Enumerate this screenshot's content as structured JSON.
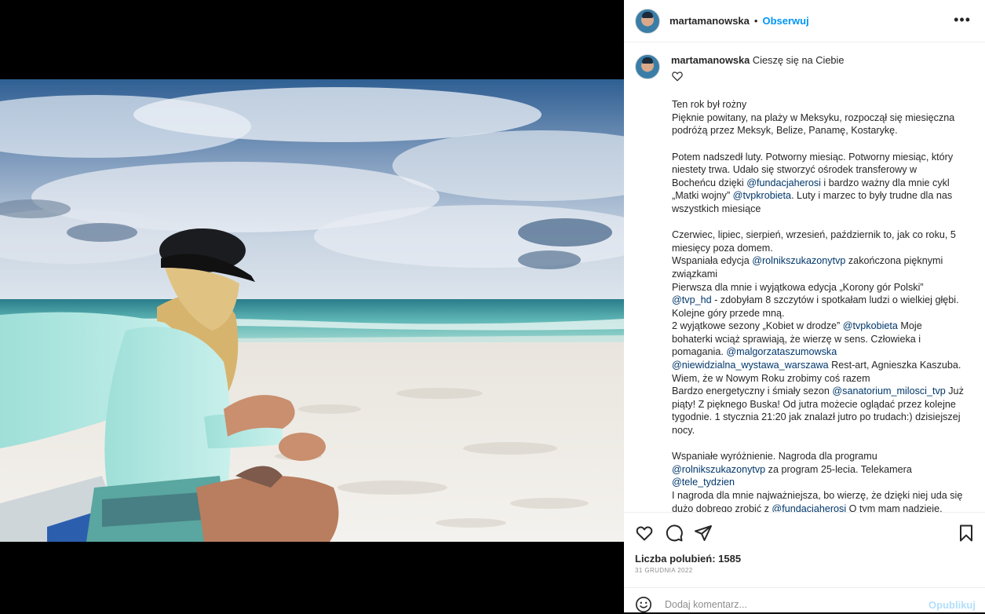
{
  "post": {
    "username": "martamanowska",
    "separator": "•",
    "follow_label": "Obserwuj",
    "more_label": "•••"
  },
  "caption": {
    "username": "martamanowska",
    "title": "Cieszę się na Ciebie",
    "lines": [
      {
        "parts": [
          {
            "t": "Ten rok był rożny"
          }
        ]
      },
      {
        "parts": [
          {
            "t": "Pięknie powitany, na plaży w Meksyku, rozpoczął się miesięczna"
          }
        ]
      },
      {
        "parts": [
          {
            "t": "podróżą przez Meksyk, Belize, Panamę, Kostarykę."
          }
        ]
      },
      {
        "parts": []
      },
      {
        "parts": [
          {
            "t": "Potem nadszedł luty. Potworny miesiąc. Potworny miesiąc, który"
          }
        ]
      },
      {
        "parts": [
          {
            "t": "niestety trwa. Udało się stworzyć ośrodek transferowy w"
          }
        ]
      },
      {
        "parts": [
          {
            "t": "Bocheńcu dzięki "
          },
          {
            "t": "@fundacjaherosi",
            "m": true
          },
          {
            "t": " i bardzo ważny dla mnie cykl"
          }
        ]
      },
      {
        "parts": [
          {
            "t": "„Matki wojny” "
          },
          {
            "t": "@tvpkrobieta",
            "m": true
          },
          {
            "t": ". Luty i marzec to były trudne dla nas"
          }
        ]
      },
      {
        "parts": [
          {
            "t": "wszystkich miesiące"
          }
        ]
      },
      {
        "parts": []
      },
      {
        "parts": [
          {
            "t": "Czerwiec, lipiec, sierpień, wrzesień, październik to, jak co roku, 5"
          }
        ]
      },
      {
        "parts": [
          {
            "t": "miesięcy poza domem."
          }
        ]
      },
      {
        "parts": [
          {
            "t": "Wspaniała edycja "
          },
          {
            "t": "@rolnikszukazonytvp",
            "m": true
          },
          {
            "t": " zakończona pięknymi"
          }
        ]
      },
      {
        "parts": [
          {
            "t": "związkami"
          }
        ]
      },
      {
        "parts": [
          {
            "t": "Pierwsza dla mnie i wyjątkowa edycja „Korony gór Polski”"
          }
        ]
      },
      {
        "parts": [
          {
            "t": "@tvp_hd",
            "m": true
          },
          {
            "t": " - zdobyłam 8 szczytów i spotkałam ludzi o wielkiej głębi."
          }
        ]
      },
      {
        "parts": [
          {
            "t": "Kolejne góry przede mną."
          }
        ]
      },
      {
        "parts": [
          {
            "t": "2 wyjątkowe sezony „Kobiet w drodze” "
          },
          {
            "t": "@tvpkobieta",
            "m": true
          },
          {
            "t": " Moje"
          }
        ]
      },
      {
        "parts": [
          {
            "t": "bohaterki wciąż sprawiają, że wierzę w sens. Człowieka i"
          }
        ]
      },
      {
        "parts": [
          {
            "t": "pomagania. "
          },
          {
            "t": "@malgorzataszumowska",
            "m": true
          }
        ]
      },
      {
        "parts": [
          {
            "t": "@niewidzialna_wystawa_warszawa",
            "m": true
          },
          {
            "t": " Rest-art, Agnieszka Kaszuba."
          }
        ]
      },
      {
        "parts": [
          {
            "t": "Wiem, że w Nowym Roku zrobimy coś razem"
          }
        ]
      },
      {
        "parts": [
          {
            "t": "Bardzo energetyczny i śmiały sezon "
          },
          {
            "t": "@sanatorium_milosci_tvp",
            "m": true
          },
          {
            "t": " Już"
          }
        ]
      },
      {
        "parts": [
          {
            "t": "piąty! Z pięknego Buska! Od jutra możecie oglądać przez kolejne"
          }
        ]
      },
      {
        "parts": [
          {
            "t": "tygodnie. 1 stycznia 21:20 jak znalazł jutro po trudach:) dzisiejszej"
          }
        ]
      },
      {
        "parts": [
          {
            "t": "nocy."
          }
        ]
      },
      {
        "parts": []
      },
      {
        "parts": [
          {
            "t": "Wspaniałe wyróżnienie. Nagroda dla programu"
          }
        ]
      },
      {
        "parts": [
          {
            "t": "@rolnikszukazonytvp",
            "m": true
          },
          {
            "t": " za program 25-lecia. Telekamera"
          }
        ]
      },
      {
        "parts": [
          {
            "t": "@tele_tydzien",
            "m": true
          }
        ]
      },
      {
        "parts": [
          {
            "t": "I nagroda dla mnie najważniejsza, bo wierzę, że dzięki niej uda się"
          }
        ]
      },
      {
        "parts": [
          {
            "t": "dużo dobrego zrobić z "
          },
          {
            "t": "@fundacjaherosi",
            "m": true
          },
          {
            "t": " O tym mam nadzieje."
          }
        ]
      }
    ]
  },
  "stats": {
    "likes_label": "Liczba polubień: 1585",
    "date": "31 GRUDNIA 2022"
  },
  "comment": {
    "placeholder": "Dodaj komentarz...",
    "publish_label": "Opublikuj"
  },
  "icons": {
    "like": "heart-icon",
    "comment": "comment-icon",
    "share": "send-icon",
    "save": "bookmark-icon",
    "emoji": "emoji-icon",
    "more": "more-icon"
  },
  "colors": {
    "accent": "#0095f6",
    "mention": "#00376b",
    "muted": "#8e8e8e",
    "publish_disabled": "#b2dffc"
  }
}
